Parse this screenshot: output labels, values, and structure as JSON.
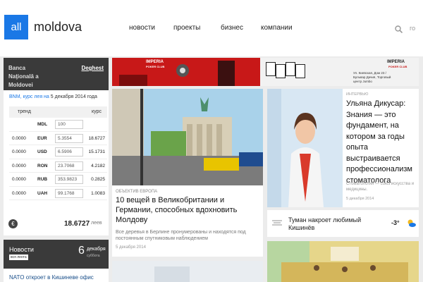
{
  "header": {
    "logo_all": "all",
    "logo_moldova": "moldova",
    "nav": [
      "новости",
      "проекты",
      "бизнес",
      "компании"
    ],
    "search_go": "го"
  },
  "currency": {
    "bank": "Banca Naţională a Moldovei",
    "provider": "Deghest",
    "bnm_link": "BNM, курс лея на",
    "bnm_date": "5 декабря 2014 года",
    "headers": {
      "trend": "тренд",
      "rate": "курс"
    },
    "rows": [
      {
        "trend": "",
        "code": "MDL",
        "amount": "100",
        "rate": ""
      },
      {
        "trend": "0.0000",
        "code": "EUR",
        "amount": "5.3554",
        "rate": "18.6727"
      },
      {
        "trend": "0.0000",
        "code": "USD",
        "amount": "6.5906",
        "rate": "15.1731"
      },
      {
        "trend": "0.0000",
        "code": "RON",
        "amount": "23.7068",
        "rate": "4.2182"
      },
      {
        "trend": "0.0000",
        "code": "RUB",
        "amount": "353.9823",
        "rate": "0.2825"
      },
      {
        "trend": "0.0000",
        "code": "UAH",
        "amount": "99.1768",
        "rate": "1.0083"
      }
    ],
    "total": "18.6727",
    "total_unit": "леев"
  },
  "news": {
    "title": "Новости",
    "all_link": "вся лента",
    "day": "6",
    "month": "декабря",
    "weekday": "суббота",
    "item": "NATO откроет в Кишиневе офис"
  },
  "banner": {
    "brand_left": "IMPERIA",
    "brand_right": "IMPERIA",
    "brand_sub": "POKER CLUB",
    "address": "Ул. Киевская, Дом 23 / Бульвар Дачия, Торговый центр Jumbo"
  },
  "main_article": {
    "tag": "ОБЪЕКТИВ ЕВРОПА",
    "title": "10 вещей в Великобритании и Германии, способных вдохновить Молдову",
    "subtitle": "Все деревья в Берлине пронумерованы и находятся под постоянным спутниковым наблюдением",
    "date": "5 декабря 2014"
  },
  "interview": {
    "tag": "ИНТЕРВЬЮ",
    "title": "Ульяна Дикусар: Знания — это фундамент, на котором за годы опыта выстраивается профессионализм стоматолога",
    "subtitle": "Стоматология — союз искусства и медицины.",
    "date": "5 декабря 2014"
  },
  "weather": {
    "text": "Туман накроет любимый Кишинёв",
    "temp": "-3°"
  },
  "colors": {
    "accent": "#1a78e6",
    "dark": "#3a3a3a",
    "banner_red": "#d62020"
  }
}
